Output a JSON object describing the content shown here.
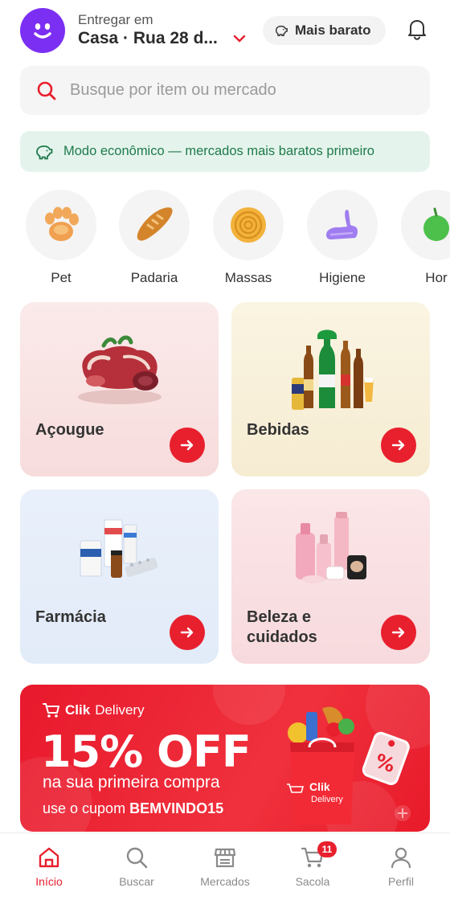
{
  "header": {
    "deliver_label": "Entregar em",
    "address": "Casa · Rua 28 d...",
    "cheap_button": "Mais barato"
  },
  "search": {
    "placeholder": "Busque por item ou mercado",
    "value": ""
  },
  "eco_banner": {
    "text": "Modo econômico — mercados mais baratos primeiro"
  },
  "categories": [
    {
      "label": "Pet",
      "icon": "paw-icon"
    },
    {
      "label": "Padaria",
      "icon": "bread-icon"
    },
    {
      "label": "Massas",
      "icon": "pasta-icon"
    },
    {
      "label": "Higiene",
      "icon": "glove-icon"
    },
    {
      "label": "Hor",
      "icon": "vegetable-icon"
    }
  ],
  "tiles": [
    {
      "title": "Açougue",
      "bg": "#f9e4e4"
    },
    {
      "title": "Bebidas",
      "bg": "#f8f1dc"
    },
    {
      "title": "Farmácia",
      "bg": "#e6eefa"
    },
    {
      "title_line1": "Beleza e",
      "title_line2": "cuidados",
      "bg": "#f9e1e4"
    }
  ],
  "promo": {
    "brand_prefix": "Clik",
    "brand_suffix": "Delivery",
    "headline": "15% OFF",
    "subline": "na sua primeira compra",
    "coupon_prefix": "use o cupom",
    "coupon_code": "BEMVINDO15",
    "bag_brand": "Clik",
    "bag_brand2": "Delivery"
  },
  "nav": {
    "items": [
      {
        "label": "Início",
        "icon": "home-icon",
        "active": true
      },
      {
        "label": "Buscar",
        "icon": "search-icon"
      },
      {
        "label": "Mercados",
        "icon": "store-icon"
      },
      {
        "label": "Sacola",
        "icon": "cart-icon",
        "badge": "11"
      },
      {
        "label": "Perfil",
        "icon": "user-icon"
      }
    ]
  },
  "colors": {
    "accent": "#e8202e",
    "avatar": "#7b2ff2",
    "eco_bg": "#e4f4ec",
    "eco_text": "#1f7a4a"
  }
}
